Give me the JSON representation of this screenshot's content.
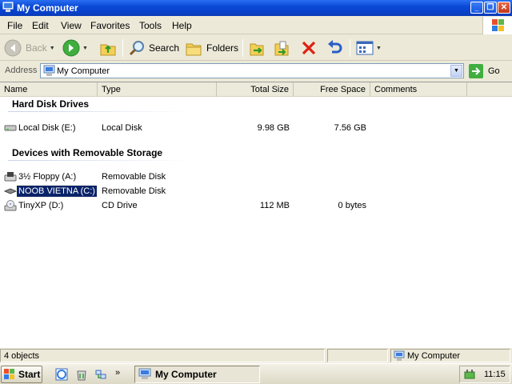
{
  "window": {
    "title": "My Computer"
  },
  "menu": [
    "File",
    "Edit",
    "View",
    "Favorites",
    "Tools",
    "Help"
  ],
  "toolbar": {
    "back_label": "Back",
    "search_label": "Search",
    "folders_label": "Folders"
  },
  "address": {
    "label": "Address",
    "value": "My Computer",
    "go_label": "Go"
  },
  "columns": [
    "Name",
    "Type",
    "Total Size",
    "Free Space",
    "Comments"
  ],
  "groups": [
    {
      "title": "Hard Disk Drives",
      "items": [
        {
          "name": "Local Disk (E:)",
          "type": "Local Disk",
          "total": "9.98 GB",
          "free": "7.56 GB",
          "icon": "hard-disk-icon",
          "selected": false
        }
      ]
    },
    {
      "title": "Devices with Removable Storage",
      "items": [
        {
          "name": "3½ Floppy (A:)",
          "type": "Removable Disk",
          "total": "",
          "free": "",
          "icon": "floppy-drive-icon",
          "selected": false
        },
        {
          "name": "NOOB VIETNA (C:)",
          "type": "Removable Disk",
          "total": "",
          "free": "",
          "icon": "removable-disk-icon",
          "selected": true
        },
        {
          "name": "TinyXP (D:)",
          "type": "CD Drive",
          "total": "112 MB",
          "free": "0 bytes",
          "icon": "cd-drive-icon",
          "selected": false
        }
      ]
    }
  ],
  "status": {
    "count": "4 objects",
    "location": "My Computer"
  },
  "taskbar": {
    "start_label": "Start",
    "task_label": "My Computer",
    "clock": "11:15"
  },
  "colors": {
    "titlebar": "#0a4ad6",
    "selection": "#0a246a",
    "face": "#ece9d8"
  }
}
